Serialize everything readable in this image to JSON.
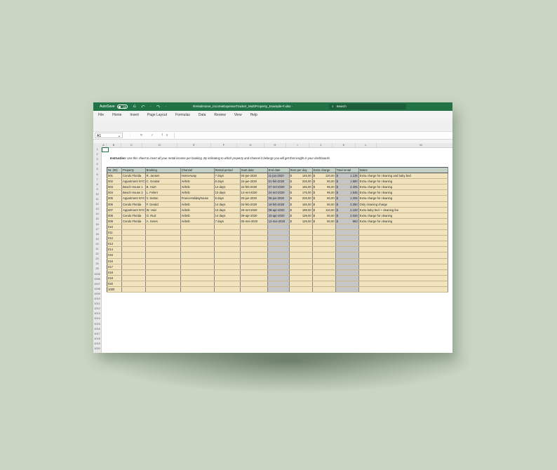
{
  "titlebar": {
    "autosave_label": "AutoSave",
    "autosave_state": "Off",
    "doc_title": "RentalHome_IncomeExpenseTracker_MultiProperty_Example-F.xlsx  ·",
    "search_placeholder": "Search",
    "quick_access": "⎌ ↶ · ↷ ·"
  },
  "menu": [
    "File",
    "Home",
    "Insert",
    "Page Layout",
    "Formulas",
    "Data",
    "Review",
    "View",
    "Help"
  ],
  "formula_bar": {
    "name_box": "A1",
    "fx_icons": "⋮ ✕ ✓ fx"
  },
  "columns": [
    "A",
    "B",
    "C",
    "D",
    "E",
    "F",
    "G",
    "H",
    "I",
    "J",
    "K",
    "L",
    "M",
    "N"
  ],
  "row_numbers": [
    "1",
    "2",
    "3",
    "4",
    "5",
    "6",
    "7",
    "8",
    "9",
    "10",
    "11",
    "12",
    "13",
    "14",
    "15",
    "16",
    "17",
    "18",
    "19",
    "20",
    "21",
    "22",
    "23",
    "24",
    "25",
    "1005",
    "1006",
    "1007",
    "1008",
    "1009",
    "1010",
    "1011",
    "1012",
    "1013",
    "1014",
    "1015",
    "1016",
    "1017",
    "1018",
    "1019",
    "1020"
  ],
  "instruction": {
    "label": "Instruction:",
    "text": " Use this sheet to insert all your rental income per booking. By indicating to which property and channel it belongs you will get that insight in your dashboards"
  },
  "table": {
    "headers": [
      "Nr. (ID)",
      "Property",
      "Booking",
      "Channel",
      "Rental period",
      "Start date",
      "End date",
      "Rent per day",
      "Extra charge",
      "Total rental",
      "Notes"
    ],
    "rows": [
      [
        "001",
        "Condo Florida",
        "R. Jansen",
        "HomeAway",
        "7 days",
        "04-jan-2020",
        "11-jan-2020",
        "$",
        "145,00",
        "$",
        "120,00",
        "$",
        "1.135",
        "Extra charge for cleaning and baby bed"
      ],
      [
        "002",
        "Appartment NYC",
        "C. Goutoir",
        "Airbnb",
        "8 days",
        "24-jan-2020",
        "01-feb-2020",
        "$",
        "225,00",
        "$",
        "80,00",
        "$",
        "1.880",
        "Extra charge for cleaning"
      ],
      [
        "003",
        "Beach House 1",
        "B. Huirt",
        "Airbnb",
        "14 days",
        "22-feb-2020",
        "07-mrt-2020",
        "$",
        "165,00",
        "$",
        "95,00",
        "$",
        "2.405",
        "Extra charge for cleaning"
      ],
      [
        "004",
        "Beach House 3",
        "L. Feilert",
        "Airbnb",
        "10 days",
        "14-mrt-2020",
        "24-mrt-2020",
        "$",
        "175,00",
        "$",
        "95,00",
        "$",
        "1.845",
        "Extra charge for cleaning"
      ],
      [
        "005",
        "Appartment NYC",
        "V. Sutton",
        "FranceHolidayhouse",
        "5 days",
        "03-jun-2020",
        "08-jun-2020",
        "$",
        "225,00",
        "$",
        "80,00",
        "$",
        "1.205",
        "Extra charge for cleaning"
      ],
      [
        "006",
        "Condo Florida",
        "F. Gerald",
        "Airbnb",
        "14 days",
        "04-feb-2020",
        "18-feb-2020",
        "$",
        "155,00",
        "$",
        "80,00",
        "$",
        "2.250",
        "Only cleaning charge"
      ],
      [
        "007",
        "Appartment NYC",
        "W. Huiz",
        "Airbnb",
        "10 days",
        "29-mrt-2020",
        "08-apr-2020",
        "$",
        "199,00",
        "$",
        "110,00",
        "$",
        "2.100",
        "Extra baby bed + cleaning fee"
      ],
      [
        "008",
        "Condo Florida",
        "O. Ruiz",
        "Airbnb",
        "14 days",
        "09-apr-2020",
        "23-apr-2020",
        "$",
        "139,00",
        "$",
        "80,00",
        "$",
        "2.026",
        "Extra charge for cleaning"
      ],
      [
        "009",
        "Condo Florida",
        "A. Seres",
        "Airbnb",
        "7 days",
        "05-mei-2020",
        "12-mei-2020",
        "$",
        "129,00",
        "$",
        "80,00",
        "$",
        "983",
        "Extra charge for cleaning"
      ],
      [
        "010",
        "",
        "",
        "",
        "",
        "",
        "",
        "",
        "",
        "",
        "",
        "",
        "",
        ""
      ],
      [
        "011",
        "",
        "",
        "",
        "",
        "",
        "",
        "",
        "",
        "",
        "",
        "",
        "",
        ""
      ],
      [
        "012",
        "",
        "",
        "",
        "",
        "",
        "",
        "",
        "",
        "",
        "",
        "",
        "",
        ""
      ],
      [
        "013",
        "",
        "",
        "",
        "",
        "",
        "",
        "",
        "",
        "",
        "",
        "",
        "",
        ""
      ],
      [
        "014",
        "",
        "",
        "",
        "",
        "",
        "",
        "",
        "",
        "",
        "",
        "",
        "",
        ""
      ],
      [
        "015",
        "",
        "",
        "",
        "",
        "",
        "",
        "",
        "",
        "",
        "",
        "",
        "",
        ""
      ],
      [
        "016",
        "",
        "",
        "",
        "",
        "",
        "",
        "",
        "",
        "",
        "",
        "",
        "",
        ""
      ],
      [
        "017",
        "",
        "",
        "",
        "",
        "",
        "",
        "",
        "",
        "",
        "",
        "",
        "",
        ""
      ],
      [
        "018",
        "",
        "",
        "",
        "",
        "",
        "",
        "",
        "",
        "",
        "",
        "",
        "",
        ""
      ],
      [
        "019",
        "",
        "",
        "",
        "",
        "",
        "",
        "",
        "",
        "",
        "",
        "",
        "",
        ""
      ],
      [
        "020",
        "",
        "",
        "",
        "",
        "",
        "",
        "",
        "",
        "",
        "",
        "",
        "",
        ""
      ],
      [
        "1000",
        "",
        "",
        "",
        "",
        "",
        "",
        "",
        "",
        "",
        "",
        "",
        "",
        ""
      ]
    ]
  },
  "colors": {
    "excel_green": "#217346",
    "header_fill": "#c3d0c6",
    "row_fill": "#f0e3be",
    "end_date_fill": "#c6c6c6",
    "background": "#c9d6c3"
  }
}
